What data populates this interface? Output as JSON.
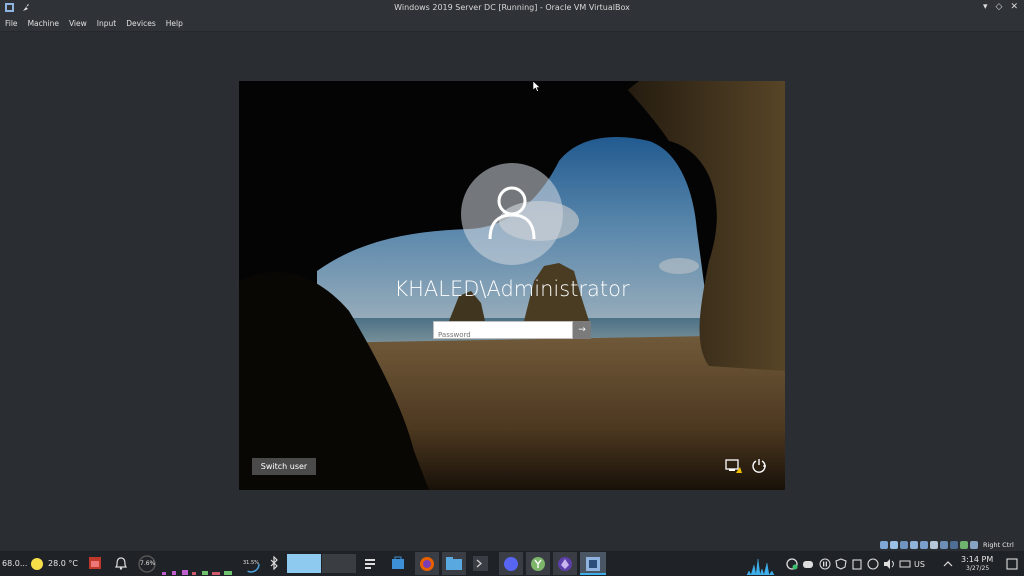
{
  "window": {
    "title": "Windows 2019 Server DC [Running] - Oracle VM VirtualBox",
    "controls": [
      "▾",
      "◇",
      "✕"
    ]
  },
  "menu": [
    "File",
    "Machine",
    "View",
    "Input",
    "Devices",
    "Help"
  ],
  "login": {
    "username": "KHALED\\Administrator",
    "password_placeholder": "Password",
    "submit_glyph": "→",
    "switch_user": "Switch user"
  },
  "taskbar": {
    "cpu_temp": "68.0...",
    "weather_temp": "28.0 °C",
    "cpu_load": "7.6%",
    "memory": "31.5%",
    "keyboard_layout": "US",
    "time": "3:14 PM",
    "date": "3/27/25",
    "host_key": "Right Ctrl"
  },
  "colors": {
    "titlebar": "#2f3237",
    "host_bg": "#2a2d31",
    "taskbar": "#1f2226"
  }
}
